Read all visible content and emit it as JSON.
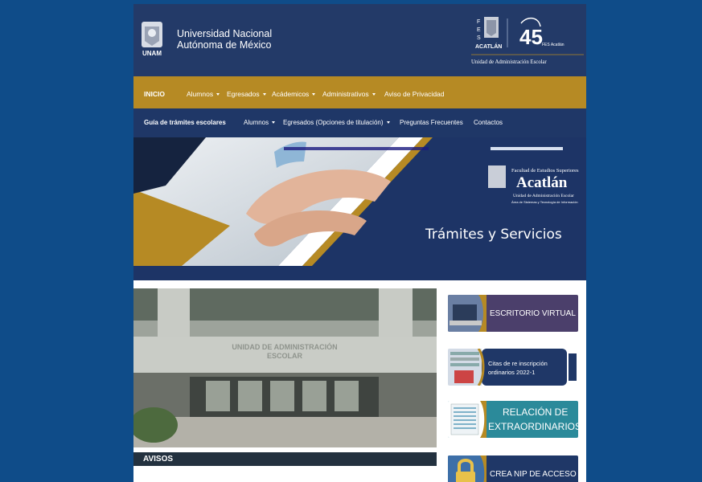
{
  "header": {
    "university_line1": "Universidad Nacional",
    "university_line2": "Autónoma de México",
    "unam_logo_text": "UNAM",
    "acatlan_logo_text": "ACATLÁN",
    "anniversary_text": "45",
    "fes_acatlan_small": "FES Acatlán",
    "unidad_text": "Unidad de Administración Escolar"
  },
  "nav_primary": {
    "home": "INICIO",
    "items": [
      "Alumnos",
      "Egresados",
      "Acádemicos",
      "Administrativos",
      "Aviso de Privacidad"
    ]
  },
  "nav_secondary": {
    "title": "Guía de trámites escolares",
    "items": [
      "Alumnos",
      "Egresados (Opciones de titulación)",
      "Preguntas Frecuentes",
      "Contactos"
    ]
  },
  "banner": {
    "faculty_line": "Facultad de Estudios Superiores",
    "campus": "Acatlán",
    "unit": "Unidad de Administración Escolar",
    "area": "Área de Sistemas y Tecnología de Información",
    "headline": "Trámites y Servicios"
  },
  "photo": {
    "sign_line1": "UNIDAD DE ADMINISTRACIÓN",
    "sign_line2": "ESCOLAR"
  },
  "avisos_label": "AVISOS",
  "side_buttons": {
    "escritorio": "ESCRITORIO VIRTUAL",
    "citas_line1": "Citas de re inscripción",
    "citas_line2": "ordinarios 2022-1",
    "relacion_line1": "RELACIÓN DE",
    "relacion_line2": "EXTRAORDINARIOS",
    "nip": "CREA NIP DE ACCESO"
  },
  "colors": {
    "background": "#0f4c89",
    "header": "#233a68",
    "nav_gold": "#b68a24",
    "nav_dark": "#1f3767",
    "banner_navy": "#1d3466"
  }
}
